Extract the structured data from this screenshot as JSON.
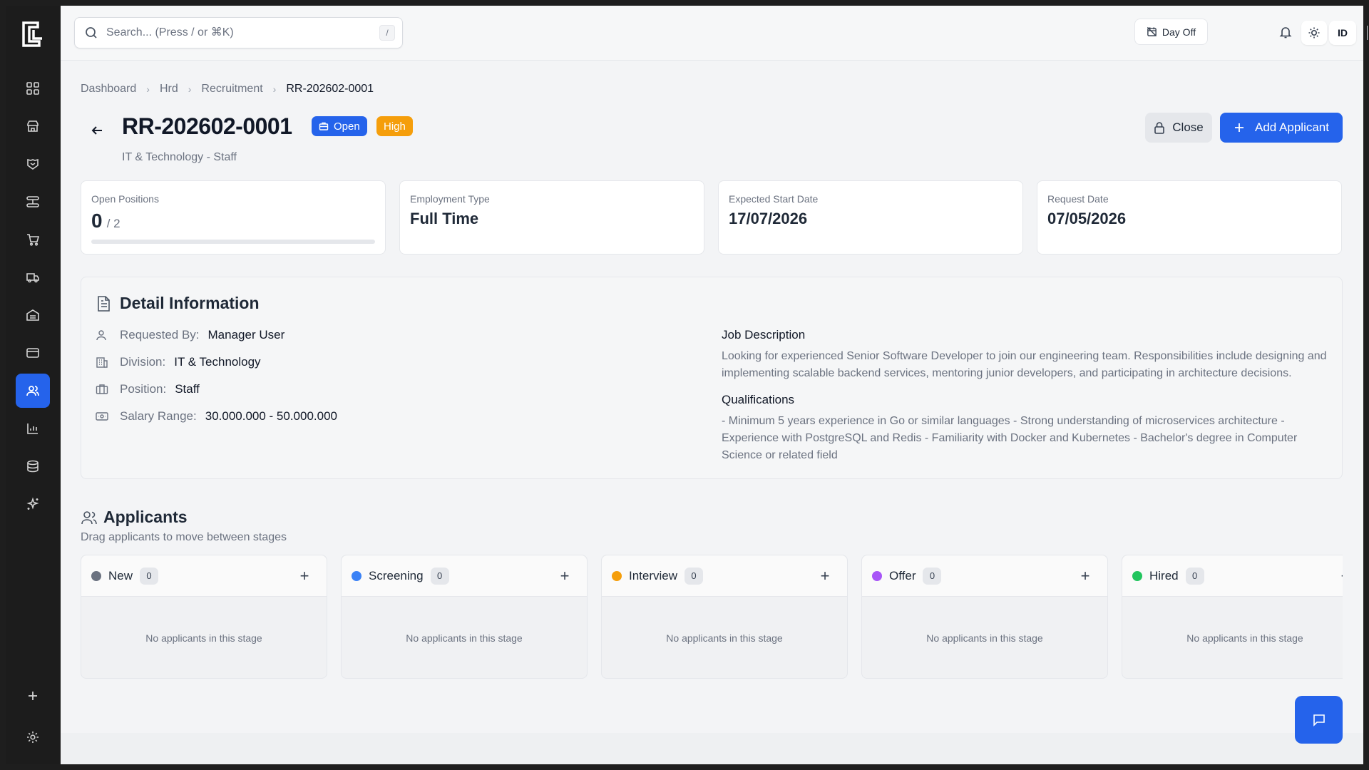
{
  "search": {
    "placeholder": "Search... (Press / or ⌘K)",
    "shortcut": "/"
  },
  "topbar": {
    "day_off_label": "Day Off",
    "language": "ID"
  },
  "breadcrumb": [
    "Dashboard",
    "Hrd",
    "Recruitment",
    "RR-202602-0001"
  ],
  "header": {
    "title": "RR-202602-0001",
    "status_badge": "Open",
    "priority_badge": "High",
    "subtitle": "IT & Technology - Staff",
    "close_label": "Close",
    "add_label": "Add Applicant"
  },
  "stats": {
    "open_positions": {
      "label": "Open Positions",
      "value": "0",
      "total": "/ 2",
      "progress": 0
    },
    "employment_type": {
      "label": "Employment Type",
      "value": "Full Time"
    },
    "expected_start": {
      "label": "Expected Start Date",
      "value": "17/07/2026"
    },
    "request_date": {
      "label": "Request Date",
      "value": "07/05/2026"
    }
  },
  "detail": {
    "title": "Detail Information",
    "requested_by_label": "Requested By:",
    "requested_by": "Manager User",
    "division_label": "Division:",
    "division": "IT & Technology",
    "position_label": "Position:",
    "position": "Staff",
    "salary_label": "Salary Range:",
    "salary": "30.000.000 - 50.000.000",
    "job_desc_title": "Job Description",
    "job_desc": "Looking for experienced Senior Software Developer to join our engineering team. Responsibilities include designing and implementing scalable backend services, mentoring junior developers, and participating in architecture decisions.",
    "qualifications_title": "Qualifications",
    "qualifications": "- Minimum 5 years experience in Go or similar languages - Strong understanding of microservices architecture - Experience with PostgreSQL and Redis - Familiarity with Docker and Kubernetes - Bachelor's degree in Computer Science or related field"
  },
  "applicants": {
    "title": "Applicants",
    "subtitle": "Drag applicants to move between stages",
    "empty_text": "No applicants in this stage",
    "stages": [
      {
        "name": "New",
        "count": "0",
        "color": "#6b7280"
      },
      {
        "name": "Screening",
        "count": "0",
        "color": "#3b82f6"
      },
      {
        "name": "Interview",
        "count": "0",
        "color": "#f59e0b"
      },
      {
        "name": "Offer",
        "count": "0",
        "color": "#a855f7"
      },
      {
        "name": "Hired",
        "count": "0",
        "color": "#22c55e"
      }
    ]
  },
  "colors": {
    "accent": "#2563eb",
    "warning": "#f59e0b",
    "sidebar": "#1c1c1c"
  },
  "icons": {
    "sidebar": [
      "dashboard-icon",
      "store-icon",
      "handshake-icon",
      "workflow-icon",
      "cart-icon",
      "truck-icon",
      "warehouse-icon",
      "card-icon",
      "users-icon",
      "chart-icon",
      "database-icon",
      "sparkle-icon",
      "plus-icon",
      "gear-icon"
    ]
  }
}
